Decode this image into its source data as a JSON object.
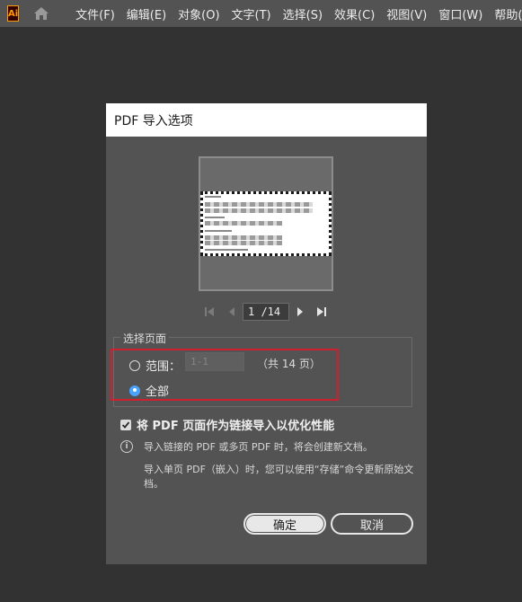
{
  "menubar": {
    "logo_text": "Ai",
    "items": [
      "文件(F)",
      "编辑(E)",
      "对象(O)",
      "文字(T)",
      "选择(S)",
      "效果(C)",
      "视图(V)",
      "窗口(W)",
      "帮助(H)"
    ]
  },
  "dialog": {
    "title": "PDF 导入选项",
    "pager": {
      "page_value": "1 /14"
    },
    "page_selection": {
      "legend": "选择页面",
      "range_label": "范围：",
      "range_value": "1-1",
      "total_text": "（共 14 页）",
      "all_label": "全部",
      "selected": "all"
    },
    "link_checkbox": {
      "checked": true,
      "label": "将 PDF 页面作为链接导入以优化性能"
    },
    "info": {
      "line1": "导入链接的 PDF 或多页 PDF 时，将会创建新文档。",
      "line2": "导入单页 PDF（嵌入）时，您可以使用“存储”命令更新原始文档。"
    },
    "ok_label": "确定",
    "cancel_label": "取消"
  },
  "colors": {
    "highlight": "#d11f2f",
    "radio_accent": "#4aa3ff",
    "logo_orange": "#ff9a00"
  }
}
